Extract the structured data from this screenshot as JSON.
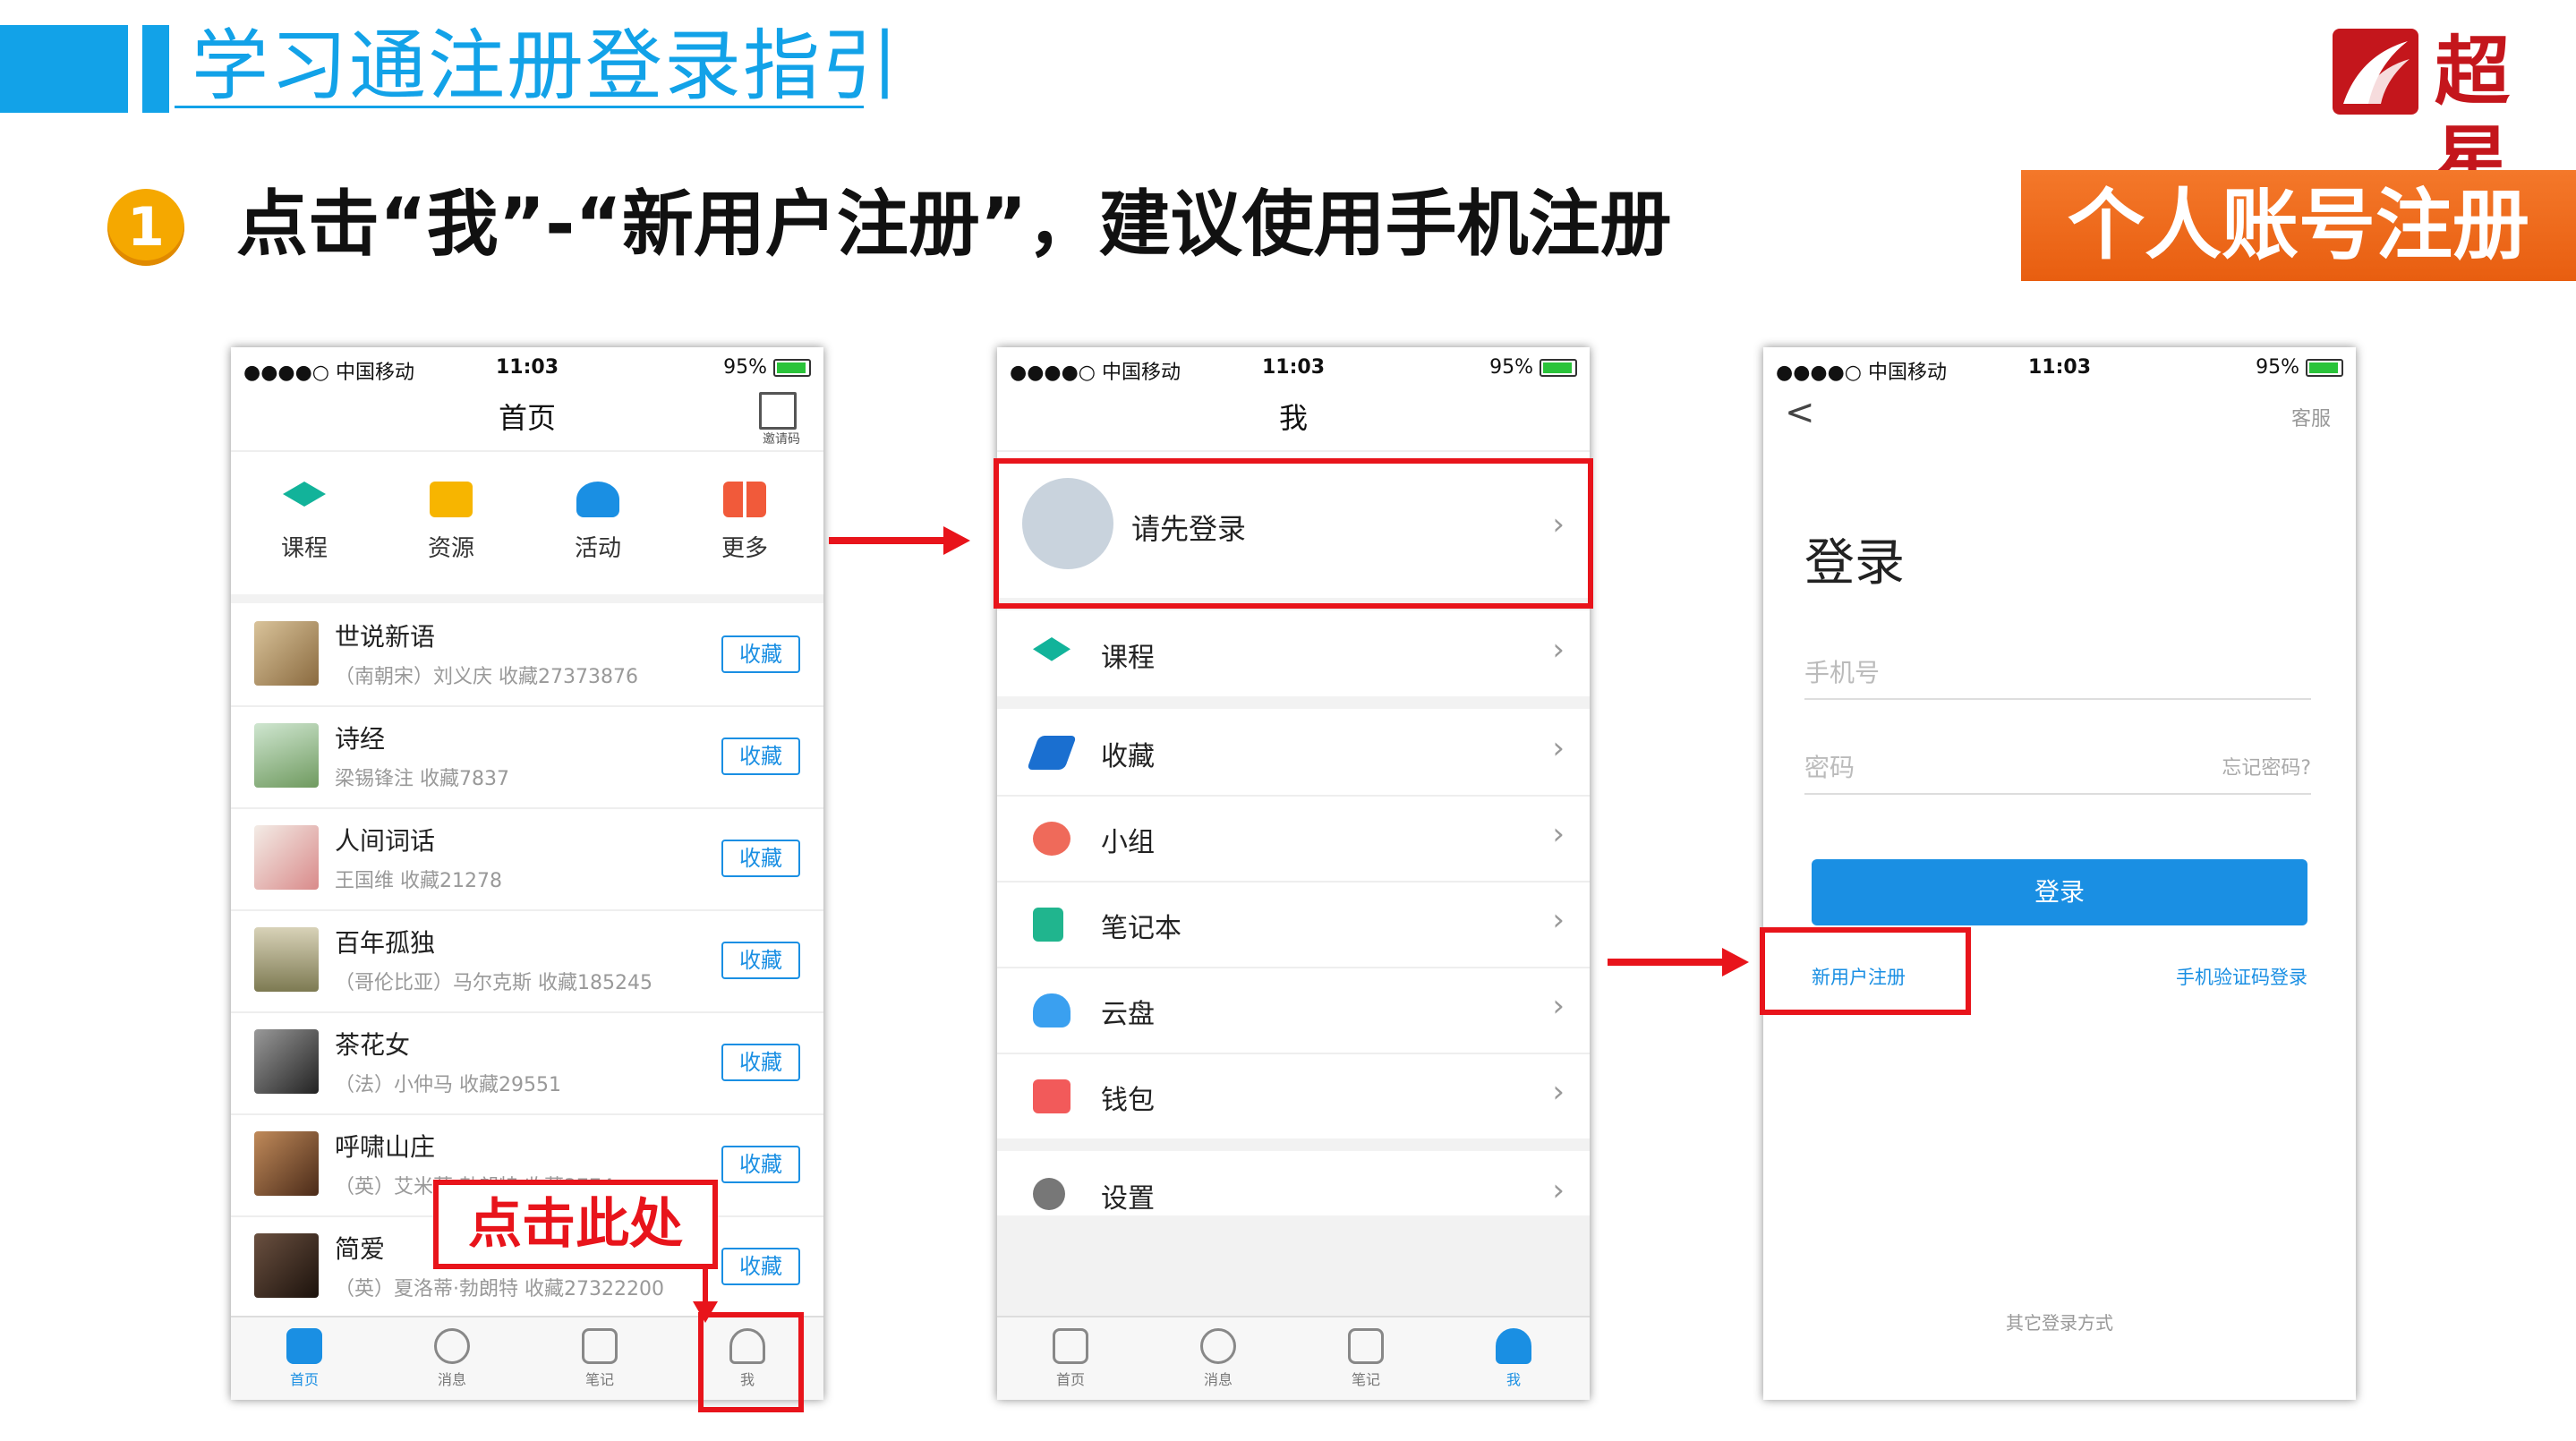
{
  "header": {
    "title": "学习通注册登录指引",
    "logo_text": "超星"
  },
  "step": {
    "number": "1",
    "text": "点击“我”-“新用户注册”，建议使用手机注册",
    "badge": "个人账号注册"
  },
  "status_bar": {
    "carrier": "●●●●○ 中国移动",
    "time": "11:03",
    "battery": "95%"
  },
  "phone1": {
    "title": "首页",
    "qr_label": "邀请码",
    "categories": [
      "课程",
      "资源",
      "活动",
      "更多"
    ],
    "books": [
      {
        "title": "世说新语",
        "sub": "（南朝宋）刘义庆 收藏27373876",
        "btn": "收藏"
      },
      {
        "title": "诗经",
        "sub": "梁锡锋注 收藏7837",
        "btn": "收藏"
      },
      {
        "title": "人间词话",
        "sub": "王国维 收藏21278",
        "btn": "收藏"
      },
      {
        "title": "百年孤独",
        "sub": "（哥伦比亚）马尔克斯 收藏185245",
        "btn": "收藏"
      },
      {
        "title": "茶花女",
        "sub": "（法）小仲马 收藏29551",
        "btn": "收藏"
      },
      {
        "title": "呼啸山庄",
        "sub": "（英）艾米莉·勃朗特 收藏3774",
        "btn": "收藏"
      },
      {
        "title": "简爱",
        "sub": "（英）夏洛蒂·勃朗特 收藏27322200",
        "btn": "收藏"
      }
    ],
    "tabs": [
      "首页",
      "消息",
      "笔记",
      "我"
    ],
    "callout": "点击此处"
  },
  "phone2": {
    "title": "我",
    "login_prompt": "请先登录",
    "menu": [
      "课程",
      "收藏",
      "小组",
      "笔记本",
      "云盘",
      "钱包",
      "设置"
    ],
    "tabs": [
      "首页",
      "消息",
      "笔记",
      "我"
    ]
  },
  "phone3": {
    "back": "<",
    "service": "客服",
    "heading": "登录",
    "phone_placeholder": "手机号",
    "password_placeholder": "密码",
    "forgot": "忘记密码?",
    "login_button": "登录",
    "register": "新用户注册",
    "sms_login": "手机验证码登录",
    "other_login": "其它登录方式"
  },
  "colors": {
    "accent_blue": "#12a2e8",
    "annotation_red": "#e8141b",
    "badge_orange": "#f4782a"
  }
}
